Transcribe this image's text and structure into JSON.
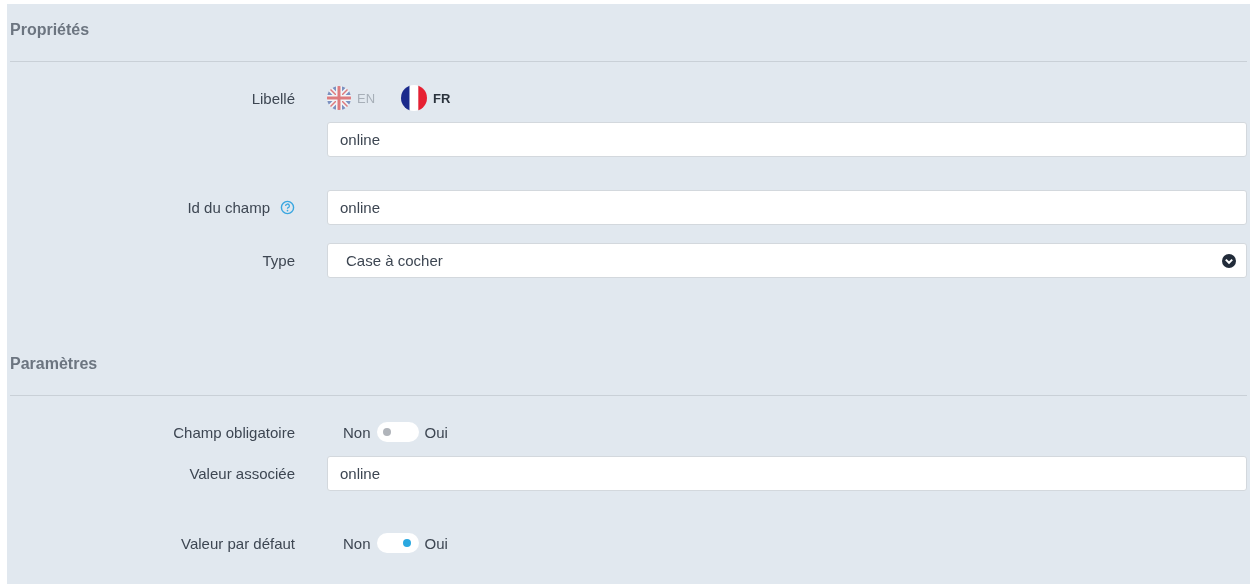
{
  "sections": [
    {
      "title": "Propriétés",
      "rows": [
        {
          "kind": "lang_input",
          "label": "Libellé",
          "languages": [
            {
              "code": "EN",
              "kind": "uk",
              "selected": false
            },
            {
              "code": "FR",
              "kind": "fr",
              "selected": true
            }
          ],
          "value": "online"
        },
        {
          "kind": "input",
          "label": "Id du champ",
          "help": true,
          "value": "online"
        },
        {
          "kind": "select",
          "label": "Type",
          "value": "Case à cocher"
        }
      ]
    },
    {
      "title": "Paramètres",
      "rows": [
        {
          "kind": "toggle",
          "label": "Champ obligatoire",
          "off_label": "Non",
          "on_label": "Oui",
          "on": false
        },
        {
          "kind": "input",
          "label": "Valeur associée",
          "value": "online"
        },
        {
          "kind": "toggle",
          "label": "Valeur par défaut",
          "off_label": "Non",
          "on_label": "Oui",
          "on": true
        }
      ]
    }
  ]
}
